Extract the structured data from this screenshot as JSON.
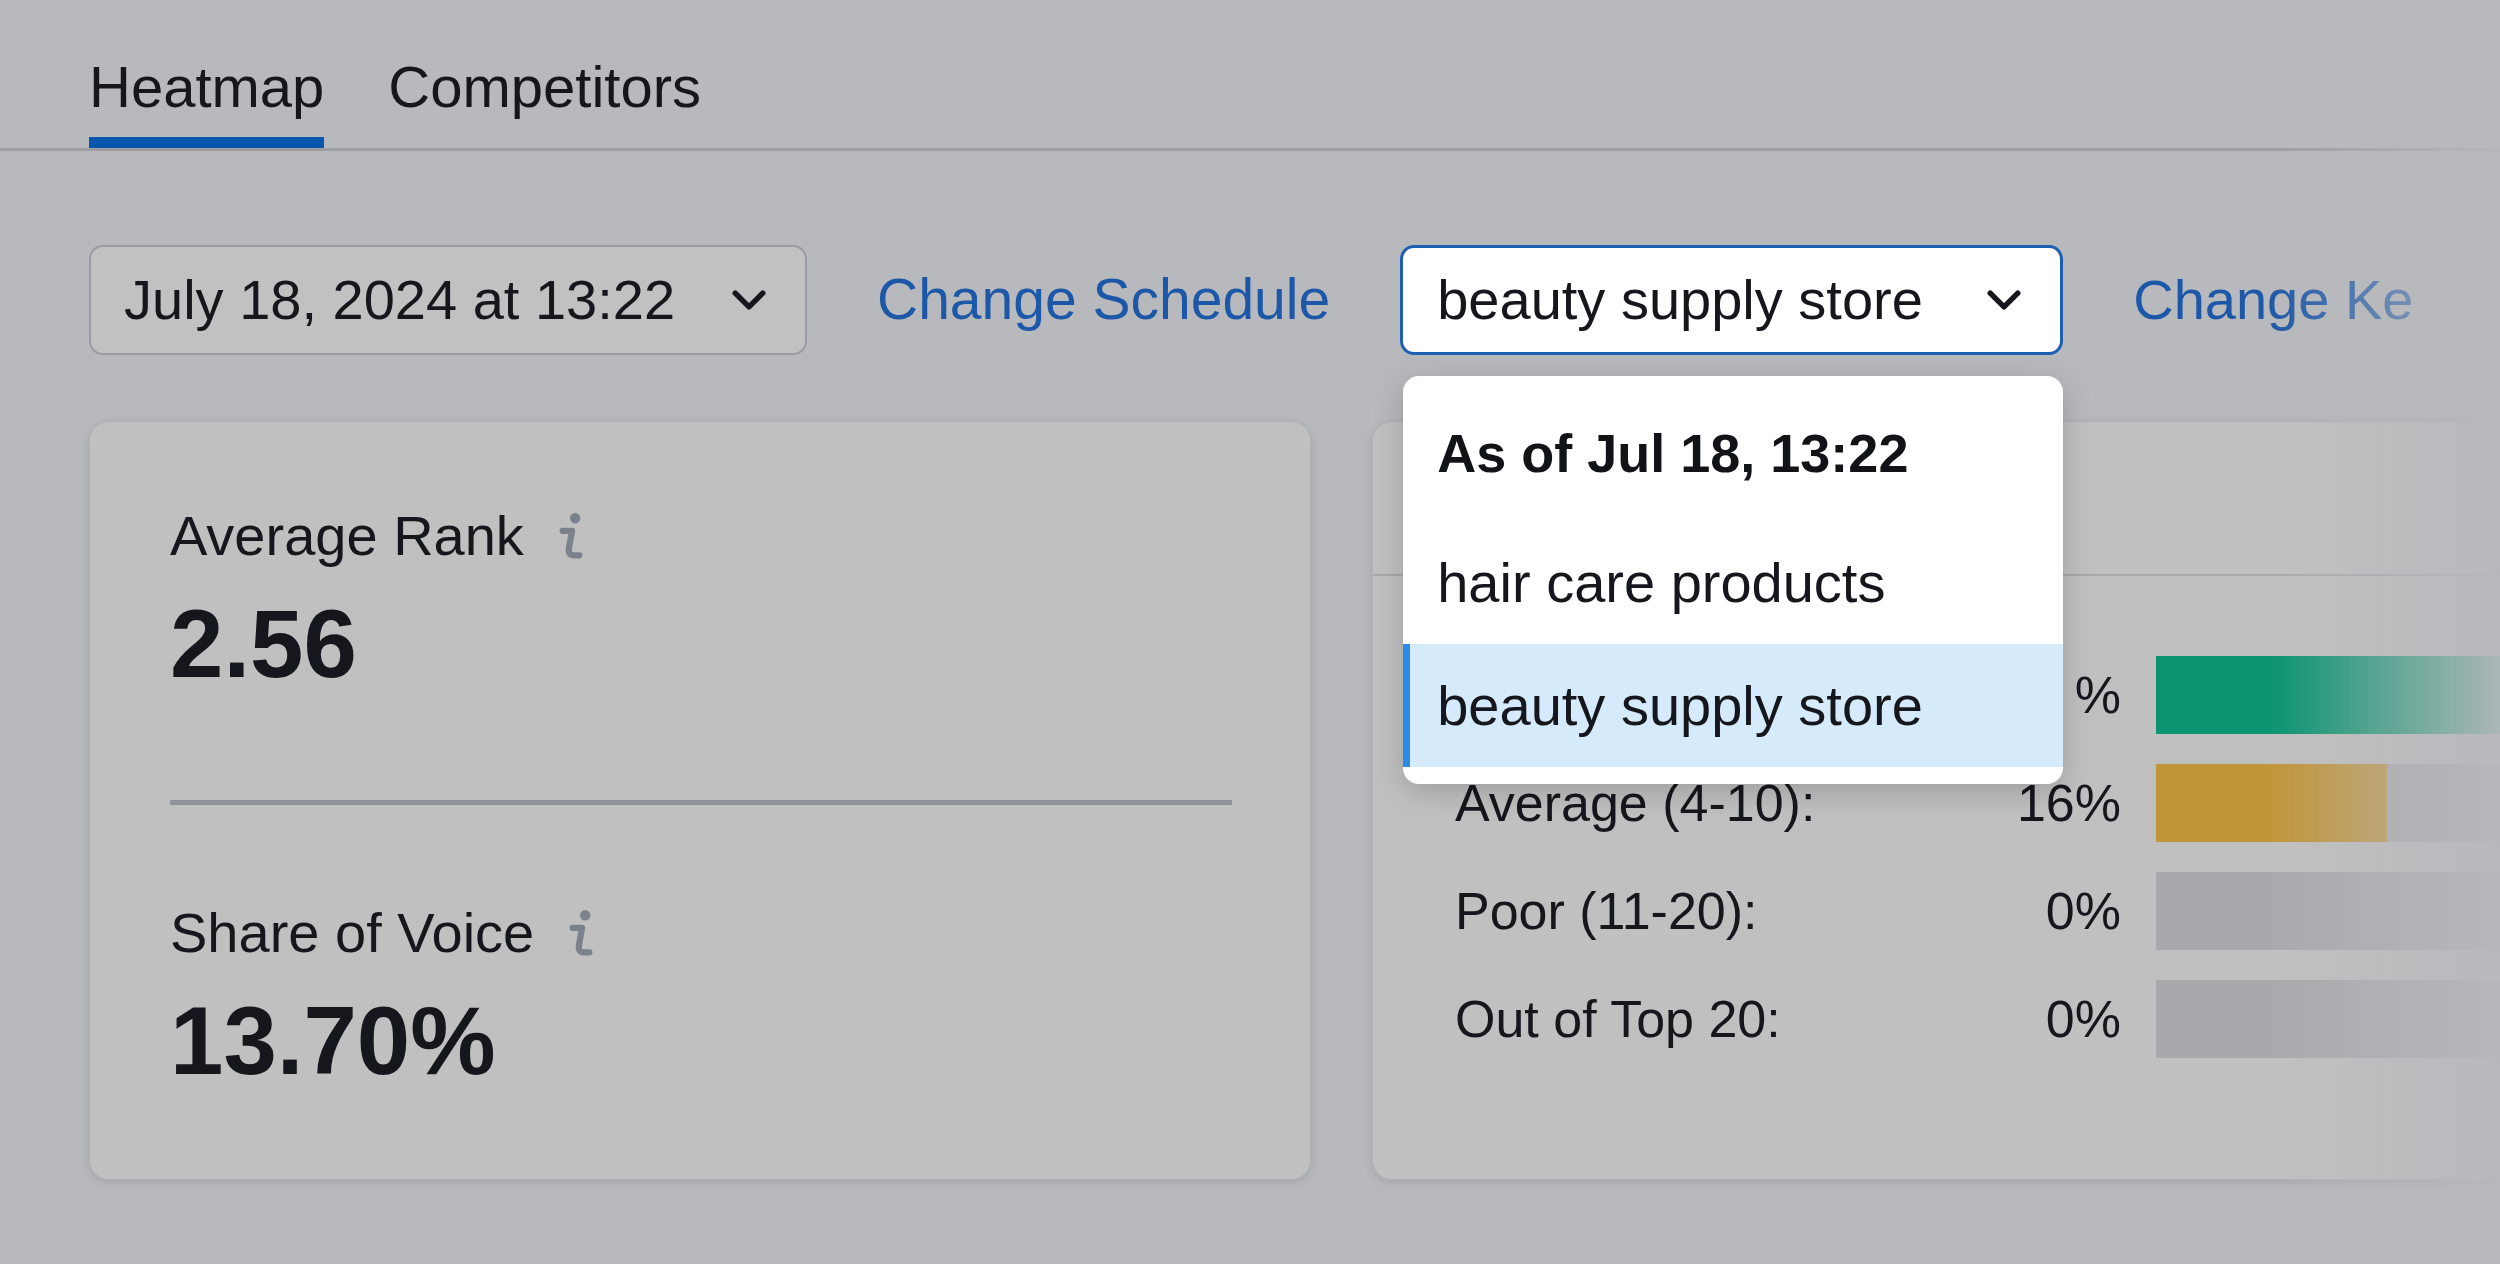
{
  "tabs": [
    {
      "label": "Heatmap",
      "selected": true
    },
    {
      "label": "Competitors",
      "selected": false
    }
  ],
  "toolbar": {
    "date_select": {
      "value": "July 18, 2024 at 13:22"
    },
    "schedule_link": "Change Schedule",
    "keyword_select": {
      "value": "beauty supply store",
      "expanded": true
    },
    "keyword_link": "Change Ke"
  },
  "keyword_menu": {
    "header": "As of Jul 18, 13:22",
    "items": [
      {
        "label": "hair care products",
        "selected": false
      },
      {
        "label": "beauty supply store",
        "selected": true
      }
    ]
  },
  "metrics_card": {
    "metrics": [
      {
        "label": "Average Rank",
        "value": "2.56"
      },
      {
        "label": "Share of Voice",
        "value": "13.70%"
      }
    ]
  },
  "distribution_card": {
    "rows": [
      {
        "value": "%",
        "level": 0.84,
        "color": "#0b9470"
      },
      {
        "label": "Average (4-10):",
        "value": "16%",
        "level": 0.16,
        "color": "#c1953a"
      },
      {
        "label": "Poor (11-20):",
        "value": "0%"
      },
      {
        "label": "Out of Top 20:",
        "value": "0%"
      }
    ]
  }
}
